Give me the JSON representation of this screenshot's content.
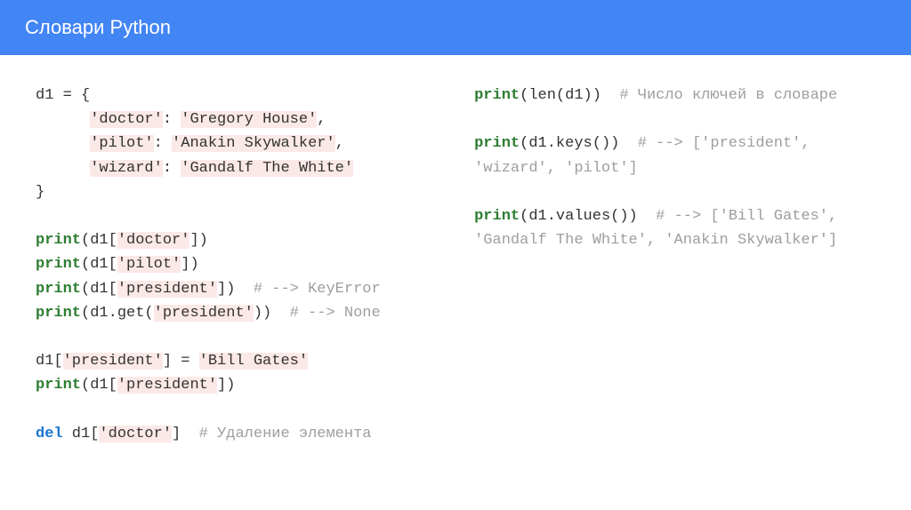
{
  "header": {
    "title": "Словари Python"
  },
  "code": {
    "left": {
      "line1": "d1 = {",
      "line2a": "      ",
      "line2b": "'doctor'",
      "line2c": ": ",
      "line2d": "'Gregory House'",
      "line2e": ",",
      "line3a": "      ",
      "line3b": "'pilot'",
      "line3c": ": ",
      "line3d": "'Anakin Skywalker'",
      "line3e": ",",
      "line4a": "      ",
      "line4b": "'wizard'",
      "line4c": ": ",
      "line4d": "'Gandalf The White'",
      "line5": "}",
      "line7a": "print",
      "line7b": "(d1[",
      "line7c": "'doctor'",
      "line7d": "])",
      "line8a": "print",
      "line8b": "(d1[",
      "line8c": "'pilot'",
      "line8d": "])",
      "line9a": "print",
      "line9b": "(d1[",
      "line9c": "'president'",
      "line9d": "])  ",
      "line9e": "# --> KeyError",
      "line10a": "print",
      "line10b": "(d1.get(",
      "line10c": "'president'",
      "line10d": "))  ",
      "line10e": "# --> None",
      "line12a": "d1[",
      "line12b": "'president'",
      "line12c": "] = ",
      "line12d": "'Bill Gates'",
      "line13a": "print",
      "line13b": "(d1[",
      "line13c": "'president'",
      "line13d": "])",
      "line15a": "del",
      "line15b": " d1[",
      "line15c": "'doctor'",
      "line15d": "]  ",
      "line15e": "# Удаление элемента"
    },
    "right": {
      "line1a": "print",
      "line1b": "(len(d1))  ",
      "line1c": "# Число ключей в словаре",
      "line3a": "print",
      "line3b": "(d1.keys())  ",
      "line3c": "# --> ['president', 'wizard', 'pilot']",
      "line5a": "print",
      "line5b": "(d1.values())  ",
      "line5c": "# --> ['Bill Gates', 'Gandalf The White', 'Anakin Skywalker']"
    }
  }
}
